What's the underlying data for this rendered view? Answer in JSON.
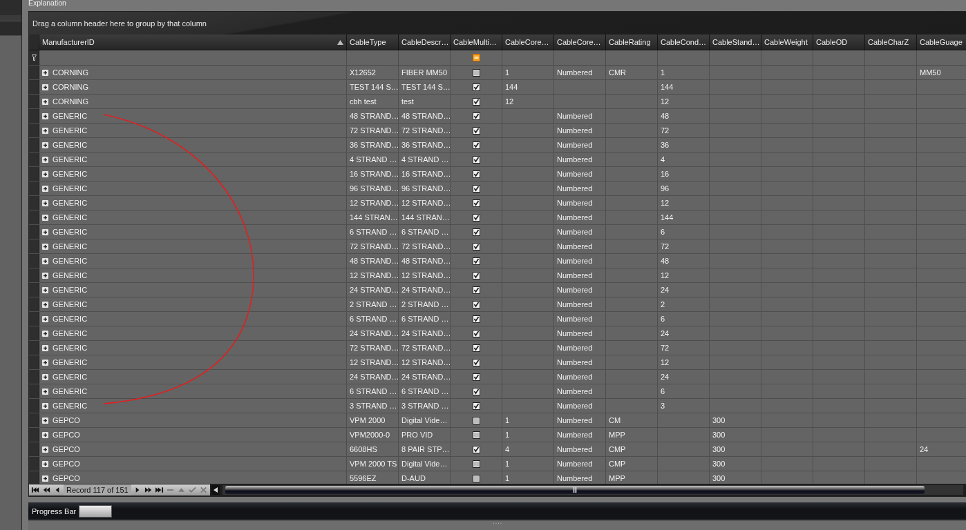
{
  "panel": {
    "title": "Explanation"
  },
  "group_panel": {
    "hint": "Drag a column header here to group by that column"
  },
  "columns": [
    {
      "label": "ManufacturerID",
      "kind": "text",
      "sorted": true
    },
    {
      "label": "CableType",
      "kind": "text",
      "sorted": false
    },
    {
      "label": "CableDescr…",
      "kind": "text",
      "sorted": false
    },
    {
      "label": "CableMulti…",
      "kind": "checkbox",
      "sorted": false
    },
    {
      "label": "CableCore…",
      "kind": "text",
      "sorted": false
    },
    {
      "label": "CableCore…",
      "kind": "text",
      "sorted": false
    },
    {
      "label": "CableRating",
      "kind": "text",
      "sorted": false
    },
    {
      "label": "CableCond…",
      "kind": "text",
      "sorted": false
    },
    {
      "label": "CableStand…",
      "kind": "text",
      "sorted": false
    },
    {
      "label": "CableWeight",
      "kind": "text",
      "sorted": false
    },
    {
      "label": "CableOD",
      "kind": "text",
      "sorted": false
    },
    {
      "label": "CableCharZ",
      "kind": "text",
      "sorted": false
    },
    {
      "label": "CableGuage",
      "kind": "text",
      "sorted": false
    }
  ],
  "rows": [
    {
      "cells": [
        "CORNING",
        "X12652",
        "FIBER MM50",
        false,
        "1",
        "Numbered",
        "CMR",
        "1",
        null,
        null,
        null,
        null,
        "MM50"
      ]
    },
    {
      "cells": [
        "CORNING",
        "TEST 144 S…",
        "TEST 144 S…",
        true,
        "144",
        null,
        null,
        "144",
        null,
        null,
        null,
        null,
        null
      ]
    },
    {
      "cells": [
        "CORNING",
        "cbh test",
        "test",
        true,
        "12",
        null,
        null,
        "12",
        null,
        null,
        null,
        null,
        null
      ]
    },
    {
      "cells": [
        "GENERIC",
        "48 STRAND…",
        "48 STRAND…",
        true,
        null,
        "Numbered",
        null,
        "48",
        null,
        null,
        null,
        null,
        null
      ]
    },
    {
      "cells": [
        "GENERIC",
        "72 STRAND…",
        "72 STRAND…",
        true,
        null,
        "Numbered",
        null,
        "72",
        null,
        null,
        null,
        null,
        null
      ]
    },
    {
      "cells": [
        "GENERIC",
        "36 STRAND…",
        "36 STRAND…",
        true,
        null,
        "Numbered",
        null,
        "36",
        null,
        null,
        null,
        null,
        null
      ]
    },
    {
      "cells": [
        "GENERIC",
        "4 STRAND …",
        "4 STRAND …",
        true,
        null,
        "Numbered",
        null,
        "4",
        null,
        null,
        null,
        null,
        null
      ]
    },
    {
      "cells": [
        "GENERIC",
        "16 STRAND…",
        "16 STRAND…",
        true,
        null,
        "Numbered",
        null,
        "16",
        null,
        null,
        null,
        null,
        null
      ]
    },
    {
      "cells": [
        "GENERIC",
        "96 STRAND…",
        "96 STRAND…",
        true,
        null,
        "Numbered",
        null,
        "96",
        null,
        null,
        null,
        null,
        null
      ]
    },
    {
      "cells": [
        "GENERIC",
        "12 STRAND…",
        "12 STRAND…",
        true,
        null,
        "Numbered",
        null,
        "12",
        null,
        null,
        null,
        null,
        null
      ]
    },
    {
      "cells": [
        "GENERIC",
        "144 STRAN…",
        "144 STRAN…",
        true,
        null,
        "Numbered",
        null,
        "144",
        null,
        null,
        null,
        null,
        null
      ]
    },
    {
      "cells": [
        "GENERIC",
        "6 STRAND …",
        "6 STRAND …",
        true,
        null,
        "Numbered",
        null,
        "6",
        null,
        null,
        null,
        null,
        null
      ]
    },
    {
      "cells": [
        "GENERIC",
        "72 STRAND…",
        "72 STRAND…",
        true,
        null,
        "Numbered",
        null,
        "72",
        null,
        null,
        null,
        null,
        null
      ]
    },
    {
      "cells": [
        "GENERIC",
        "48 STRAND…",
        "48 STRAND…",
        true,
        null,
        "Numbered",
        null,
        "48",
        null,
        null,
        null,
        null,
        null
      ]
    },
    {
      "cells": [
        "GENERIC",
        "12 STRAND…",
        "12 STRAND…",
        true,
        null,
        "Numbered",
        null,
        "12",
        null,
        null,
        null,
        null,
        null
      ]
    },
    {
      "cells": [
        "GENERIC",
        "24 STRAND…",
        "24 STRAND…",
        true,
        null,
        "Numbered",
        null,
        "24",
        null,
        null,
        null,
        null,
        null
      ]
    },
    {
      "cells": [
        "GENERIC",
        "2 STRAND …",
        "2 STRAND …",
        true,
        null,
        "Numbered",
        null,
        "2",
        null,
        null,
        null,
        null,
        null
      ]
    },
    {
      "cells": [
        "GENERIC",
        "6 STRAND …",
        "6 STRAND …",
        true,
        null,
        "Numbered",
        null,
        "6",
        null,
        null,
        null,
        null,
        null
      ]
    },
    {
      "cells": [
        "GENERIC",
        "24 STRAND…",
        "24 STRAND…",
        true,
        null,
        "Numbered",
        null,
        "24",
        null,
        null,
        null,
        null,
        null
      ]
    },
    {
      "cells": [
        "GENERIC",
        "72 STRAND…",
        "72 STRAND…",
        true,
        null,
        "Numbered",
        null,
        "72",
        null,
        null,
        null,
        null,
        null
      ]
    },
    {
      "cells": [
        "GENERIC",
        "12 STRAND…",
        "12 STRAND…",
        true,
        null,
        "Numbered",
        null,
        "12",
        null,
        null,
        null,
        null,
        null
      ]
    },
    {
      "cells": [
        "GENERIC",
        "24 STRAND…",
        "24 STRAND…",
        true,
        null,
        "Numbered",
        null,
        "24",
        null,
        null,
        null,
        null,
        null
      ]
    },
    {
      "cells": [
        "GENERIC",
        "6 STRAND …",
        "6 STRAND …",
        true,
        null,
        "Numbered",
        null,
        "6",
        null,
        null,
        null,
        null,
        null
      ]
    },
    {
      "cells": [
        "GENERIC",
        "3 STRAND …",
        "3 STRAND …",
        true,
        null,
        "Numbered",
        null,
        "3",
        null,
        null,
        null,
        null,
        null
      ]
    },
    {
      "cells": [
        "GEPCO",
        "VPM 2000",
        "Digital Vide…",
        false,
        "1",
        "Numbered",
        "CM",
        null,
        "300",
        null,
        null,
        null,
        null
      ]
    },
    {
      "cells": [
        "GEPCO",
        "VPM2000-0",
        "PRO VID",
        false,
        "1",
        "Numbered",
        "MPP",
        null,
        "300",
        null,
        null,
        null,
        null
      ]
    },
    {
      "cells": [
        "GEPCO",
        "6608HS",
        "8 PAIR STP…",
        true,
        "4",
        "Numbered",
        "CMP",
        null,
        "300",
        null,
        null,
        null,
        "24"
      ]
    },
    {
      "cells": [
        "GEPCO",
        "VPM 2000 TS",
        "Digital Vide…",
        false,
        "1",
        "Numbered",
        "CMP",
        null,
        "300",
        null,
        null,
        null,
        null
      ]
    },
    {
      "cells": [
        "GEPCO",
        "5596EZ",
        "D-AUD",
        false,
        "1",
        "Numbered",
        "MPP",
        null,
        "300",
        null,
        null,
        null,
        null
      ]
    }
  ],
  "navigator": {
    "before": [
      {
        "kind": "first",
        "disabled": false
      },
      {
        "kind": "prev_page",
        "disabled": false
      },
      {
        "kind": "prev",
        "disabled": false
      }
    ],
    "record_label": "Record 117 of 151",
    "after": [
      {
        "kind": "next",
        "disabled": false
      },
      {
        "kind": "next_page",
        "disabled": false
      },
      {
        "kind": "last",
        "disabled": false
      },
      {
        "kind": "remove",
        "disabled": true
      },
      {
        "kind": "up",
        "disabled": true
      },
      {
        "kind": "accept",
        "disabled": true
      },
      {
        "kind": "cancel",
        "disabled": true
      }
    ]
  },
  "status": {
    "label": "Progress Bar",
    "level": 1
  }
}
